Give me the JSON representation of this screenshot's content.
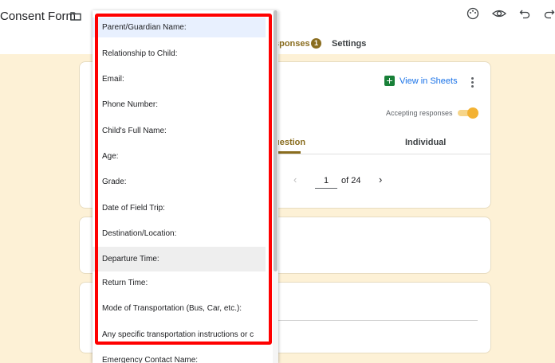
{
  "header": {
    "form_title": "Consent Form",
    "icons": [
      "folder-icon",
      "palette-icon",
      "preview-eye-icon",
      "undo-icon",
      "redo-icon"
    ]
  },
  "tabs": {
    "responses_label": "sponses",
    "responses_count": "1",
    "settings_label": "Settings"
  },
  "summary": {
    "view_in_sheets": "View in Sheets",
    "accepting_responses": "Accepting responses",
    "accepting_on": true,
    "subtab_question": "uestion",
    "subtab_individual": "Individual"
  },
  "pager": {
    "prev": "‹",
    "current": "1",
    "of_label": "of  24",
    "next": "›"
  },
  "dropdown": {
    "items": [
      "Parent/Guardian Name:",
      "Relationship to Child:",
      "Email:",
      "Phone Number:",
      "Child's Full Name:",
      "Age:",
      "Grade:",
      "Date of Field Trip:",
      "Destination/Location:",
      "Departure Time:",
      "Return Time:",
      "Mode of Transportation (Bus, Car, etc.):",
      "Any specific transportation instructions or c",
      "Emergency Contact Name:"
    ],
    "selected_index": 0,
    "hovered_index": 9
  },
  "colors": {
    "background": "#fdf1d6",
    "accent": "#8a6d1f",
    "highlight": "#ff0000",
    "sheets_green": "#188038",
    "link_blue": "#1a73e8"
  }
}
